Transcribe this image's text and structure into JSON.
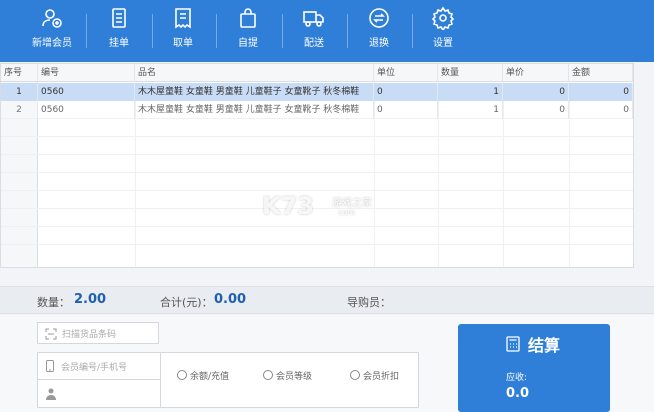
{
  "toolbar": {
    "buttons": [
      {
        "label": "新增会员",
        "icon": "add-member-icon"
      },
      {
        "label": "挂单",
        "icon": "hold-order-icon"
      },
      {
        "label": "取单",
        "icon": "retrieve-order-icon"
      },
      {
        "label": "自提",
        "icon": "pickup-bag-icon"
      },
      {
        "label": "配送",
        "icon": "delivery-truck-icon"
      },
      {
        "label": "退换",
        "icon": "return-exchange-icon"
      },
      {
        "label": "设置",
        "icon": "settings-gear-icon"
      }
    ]
  },
  "table": {
    "headers": [
      "序号",
      "编号",
      "品名",
      "单位",
      "数量",
      "单价",
      "金额"
    ],
    "rows": [
      {
        "idx": "1",
        "code": "0560",
        "name": "木木屋童鞋 女童鞋 男童鞋 儿童鞋子 女童靴子 秋冬棉鞋",
        "unit": "0",
        "qty": "1",
        "price": "0",
        "amount": "0"
      },
      {
        "idx": "2",
        "code": "0560",
        "name": "木木屋童鞋 女童鞋 男童鞋 儿童鞋子 女童靴子 秋冬棉鞋",
        "unit": "0",
        "qty": "1",
        "price": "0",
        "amount": "0"
      }
    ]
  },
  "watermark": {
    "text": "K73",
    "sub": "游戏之家",
    "url": "com"
  },
  "summary": {
    "qty_label": "数量：",
    "qty_value": "2.00",
    "total_label": "合计(元)：",
    "total_value": "0.00",
    "guide_label": "导购员："
  },
  "bottom": {
    "scan_placeholder": "扫描货品条码",
    "member_placeholder": "会员编号/手机号",
    "options": [
      "余额/充值",
      "会员等级",
      "会员折扣"
    ]
  },
  "pay": {
    "title": "结算",
    "due_label": "应收:",
    "due_value": "0.0"
  },
  "colors": {
    "accent": "#2f7fd8",
    "selected_row": "#c9dcf6",
    "value_blue": "#1e5fae"
  }
}
